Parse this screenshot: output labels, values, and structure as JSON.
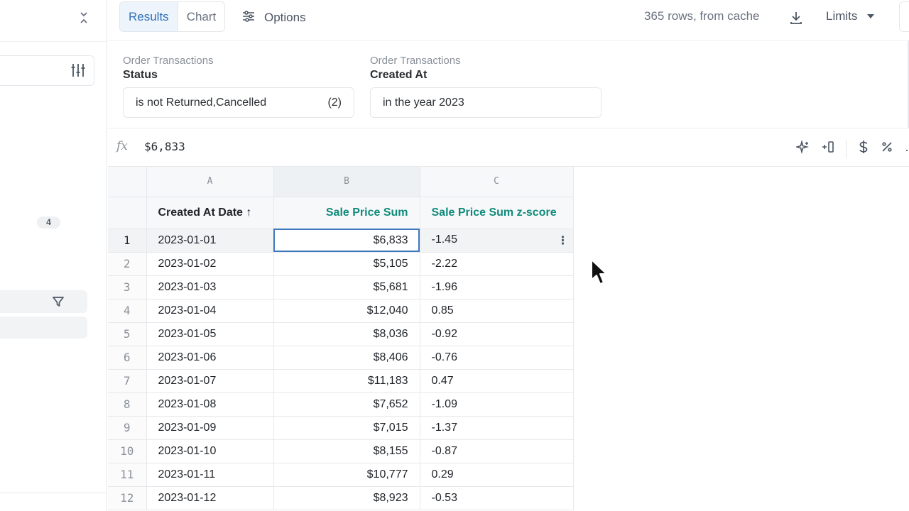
{
  "topbar": {
    "tabs": [
      {
        "label": "Results",
        "active": true
      },
      {
        "label": "Chart",
        "active": false
      }
    ],
    "options_label": "Options",
    "rows_info": "365 rows, from cache",
    "limits_label": "Limits"
  },
  "left_panel": {
    "count_badge": "4"
  },
  "filters": [
    {
      "source": "Order Transactions",
      "field": "Status",
      "value": "is not Returned,Cancelled",
      "count": "(2)"
    },
    {
      "source": "Order Transactions",
      "field": "Created At",
      "value": "in the year 2023",
      "count": ""
    }
  ],
  "formula_bar": {
    "fx_symbol": "𝑓x",
    "value": "$6,833"
  },
  "grid": {
    "column_letters": [
      "A",
      "B",
      "C"
    ],
    "headers": [
      "Created At Date ↑",
      "Sale Price Sum",
      "Sale Price Sum z-score"
    ],
    "rows": [
      {
        "n": "1",
        "date": "2023-01-01",
        "sum": "$6,833",
        "z": "-1.45"
      },
      {
        "n": "2",
        "date": "2023-01-02",
        "sum": "$5,105",
        "z": "-2.22"
      },
      {
        "n": "3",
        "date": "2023-01-03",
        "sum": "$5,681",
        "z": "-1.96"
      },
      {
        "n": "4",
        "date": "2023-01-04",
        "sum": "$12,040",
        "z": "0.85"
      },
      {
        "n": "5",
        "date": "2023-01-05",
        "sum": "$8,036",
        "z": "-0.92"
      },
      {
        "n": "6",
        "date": "2023-01-06",
        "sum": "$8,406",
        "z": "-0.76"
      },
      {
        "n": "7",
        "date": "2023-01-07",
        "sum": "$11,183",
        "z": "0.47"
      },
      {
        "n": "8",
        "date": "2023-01-08",
        "sum": "$7,652",
        "z": "-1.09"
      },
      {
        "n": "9",
        "date": "2023-01-09",
        "sum": "$7,015",
        "z": "-1.37"
      },
      {
        "n": "10",
        "date": "2023-01-10",
        "sum": "$8,155",
        "z": "-0.87"
      },
      {
        "n": "11",
        "date": "2023-01-11",
        "sum": "$10,777",
        "z": "0.29"
      },
      {
        "n": "12",
        "date": "2023-01-12",
        "sum": "$8,923",
        "z": "-0.53"
      }
    ]
  },
  "colors": {
    "accent": "#2f6fb6",
    "calc_header": "#0f8a7a",
    "selection": "#3f78bd"
  }
}
